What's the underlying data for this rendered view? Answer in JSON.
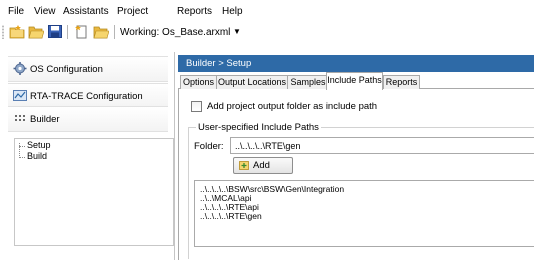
{
  "menu": [
    "File",
    "View",
    "Assistants",
    "Project",
    "Reports",
    "Help"
  ],
  "toolbar": {
    "working_label": "Working: Os_Base.arxml",
    "icons": [
      "new-project-icon",
      "open-folder-icon",
      "save-icon",
      "new-item-icon",
      "open-item-icon"
    ]
  },
  "sidebar": {
    "buttons": [
      {
        "label": "OS Configuration",
        "icon": "gear-icon"
      },
      {
        "label": "RTA-TRACE Configuration",
        "icon": "trace-icon"
      },
      {
        "label": "Builder",
        "icon": "grid-icon"
      }
    ],
    "tree": [
      "Setup",
      "Build"
    ]
  },
  "header": {
    "breadcrumb": "Builder  >  Setup"
  },
  "tabs": [
    {
      "label": "Options",
      "active": false
    },
    {
      "label": "Output Locations",
      "active": false
    },
    {
      "label": "Samples",
      "active": false
    },
    {
      "label": "Include Paths",
      "active": true
    },
    {
      "label": "Reports",
      "active": false
    }
  ],
  "content": {
    "checkbox_label": "Add project output folder as include path",
    "checkbox_checked": false,
    "group_title": "User-specified Include Paths",
    "folder_label": "Folder:",
    "folder_value": "..\\..\\..\\..\\RTE\\gen",
    "add_label": "Add",
    "paths": [
      "..\\..\\..\\..\\BSW\\src\\BSW\\Gen\\Integration",
      "..\\..\\MCAL\\api",
      "..\\..\\..\\..\\RTE\\api",
      "..\\..\\..\\..\\RTE\\gen"
    ]
  },
  "colors": {
    "header_bg": "#2e6aa7",
    "tab_border": "#a9a9a9"
  }
}
